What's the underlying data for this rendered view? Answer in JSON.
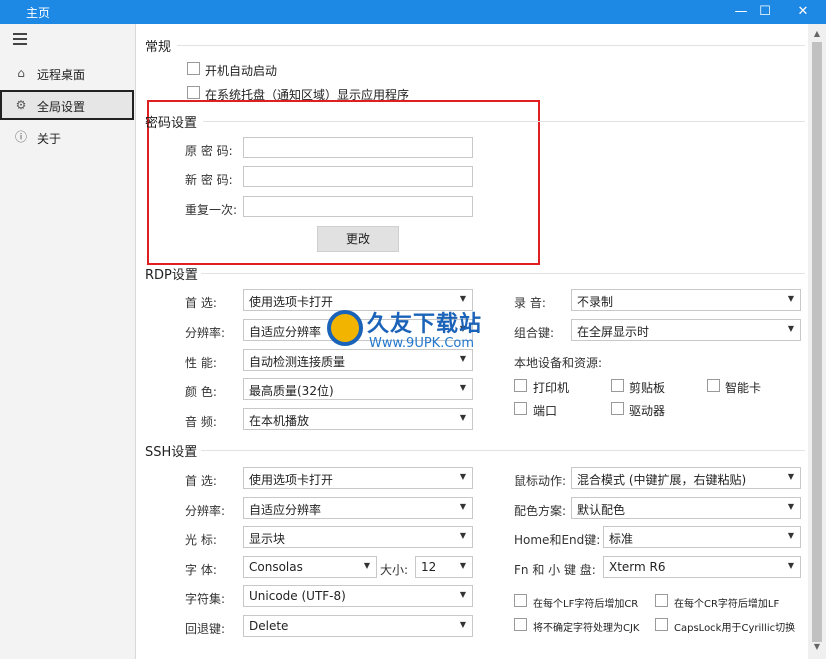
{
  "window": {
    "title": "主页",
    "minimize": "—",
    "maximize": "☐",
    "close": "✕"
  },
  "sidebar": {
    "items": [
      {
        "label": "远程桌面",
        "icon": "home-icon"
      },
      {
        "label": "全局设置",
        "icon": "gear-icon"
      },
      {
        "label": "关于",
        "icon": "info-icon"
      }
    ]
  },
  "general": {
    "title": "常规",
    "autostart": "开机自动启动",
    "tray": "在系统托盘（通知区域）显示应用程序"
  },
  "password": {
    "title": "密码设置",
    "old_label": "原 密 码:",
    "new_label": "新 密 码:",
    "repeat_label": "重复一次:",
    "change_button": "更改"
  },
  "rdp": {
    "title": "RDP设置",
    "preferred_label": "首 选:",
    "preferred_value": "使用选项卡打开",
    "resolution_label": "分辨率:",
    "resolution_value": "自适应分辨率",
    "performance_label": "性 能:",
    "performance_value": "自动检测连接质量",
    "color_label": "颜 色:",
    "color_value": "最高质量(32位)",
    "audio_label": "音 频:",
    "audio_value": "在本机播放",
    "record_label": "录 音:",
    "record_value": "不录制",
    "combo_label": "组合键:",
    "combo_value": "在全屏显示时",
    "local_devices": "本地设备和资源:",
    "printer": "打印机",
    "clipboard": "剪贴板",
    "smartcard": "智能卡",
    "port": "端口",
    "drive": "驱动器"
  },
  "ssh": {
    "title": "SSH设置",
    "preferred_label": "首 选:",
    "preferred_value": "使用选项卡打开",
    "resolution_label": "分辨率:",
    "resolution_value": "自适应分辨率",
    "cursor_label": "光 标:",
    "cursor_value": "显示块",
    "font_label": "字 体:",
    "font_value": "Consolas",
    "size_label": "大小:",
    "size_value": "12",
    "charset_label": "字符集:",
    "charset_value": "Unicode (UTF-8)",
    "backspace_label": "回退键:",
    "backspace_value": "Delete",
    "mouse_label": "鼠标动作:",
    "mouse_value": "混合模式 (中键扩展，右键粘贴)",
    "scheme_label": "配色方案:",
    "scheme_value": "默认配色",
    "homeend_label": "Home和End键:",
    "homeend_value": "标准",
    "fn_label": "Fn 和 小 键 盘:",
    "fn_value": "Xterm R6",
    "lf_cr": "在每个LF字符后增加CR",
    "cr_lf": "在每个CR字符后增加LF",
    "cjk": "将不确定字符处理为CJK",
    "capslock": "CapsLock用于Cyrillic切换"
  },
  "watermark": {
    "name": "久友下载站",
    "url": "Www.9UPK.Com"
  },
  "colors": {
    "titlebar": "#1e88e5",
    "highlight_box": "#e02020"
  }
}
